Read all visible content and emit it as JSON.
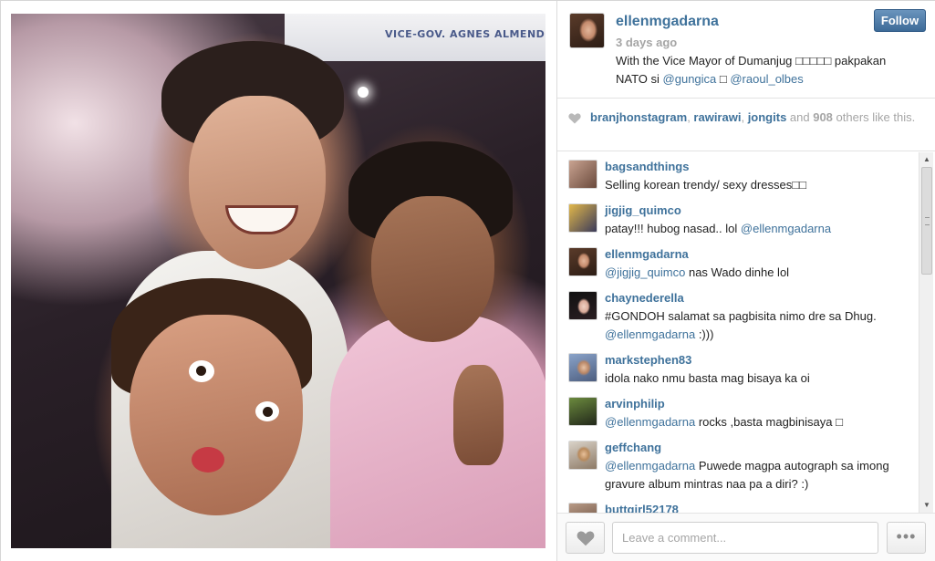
{
  "photo": {
    "banner_text": "VICE-GOV. AGNES ALMENDRAS MAG"
  },
  "post": {
    "owner": "ellenmgadarna",
    "time_ago": "3 days ago",
    "caption_text": "With the Vice Mayor of Dumanjug □□□□□ pakpakan NATO si ",
    "caption_mention_1": "@gungica",
    "caption_middle": " □ ",
    "caption_mention_2": "@raoul_olbes",
    "follow_label": "Follow"
  },
  "likes": {
    "likers": [
      "branjhonstagram",
      "rawirawi",
      "jongits"
    ],
    "sep_1": ", ",
    "sep_2": ", ",
    "and_text": " and ",
    "count": "908",
    "suffix": " others like this."
  },
  "comments": [
    {
      "user": "bagsandthings",
      "pre": "Selling korean trendy/ sexy dresses□□",
      "mention": "",
      "post": "",
      "avatar_color": "#8a6b5c"
    },
    {
      "user": "jigjig_quimco",
      "pre": "patay!!! hubog nasad.. lol ",
      "mention": "@ellenmgadarna",
      "post": "",
      "avatar_color": "#b58a2e"
    },
    {
      "user": "ellenmgadarna",
      "pre": "",
      "mention": "@jigjig_quimco",
      "post": " nas Wado dinhe lol",
      "avatar_color": "#7a4a36"
    },
    {
      "user": "chaynederella",
      "pre": "#GONDOH salamat sa pagbisita nimo dre sa Dhug. ",
      "mention": "@ellenmgadarna",
      "post": " :)))",
      "avatar_color": "#2a1e22"
    },
    {
      "user": "markstephen83",
      "pre": "idola nako nmu basta mag bisaya ka oi",
      "mention": "",
      "post": "",
      "avatar_color": "#5b6e8f"
    },
    {
      "user": "arvinphilip",
      "pre": "",
      "mention": "@ellenmgadarna",
      "post": " rocks ,basta magbinisaya □",
      "avatar_color": "#3d4a2e"
    },
    {
      "user": "geffchang",
      "pre": "",
      "mention": "@ellenmgadarna",
      "post": " Puwede magpa autograph sa imong gravure album mintras naa pa a diri? :)",
      "avatar_color": "#a67a52"
    },
    {
      "user": "buttgirl52178",
      "pre": "",
      "mention": "",
      "post": "",
      "avatar_color": "#6e5546"
    }
  ],
  "footer": {
    "comment_placeholder": "Leave a comment...",
    "more_label": "•••"
  },
  "scrollbar": {
    "up_arrow": "▲",
    "down_arrow": "▼"
  },
  "icons": {
    "like": "heart-icon",
    "more": "ellipsis-icon"
  },
  "colors": {
    "link_blue": "#3f729b",
    "muted_gray": "#a5a5a5",
    "follow_button": "#3d6b98"
  }
}
